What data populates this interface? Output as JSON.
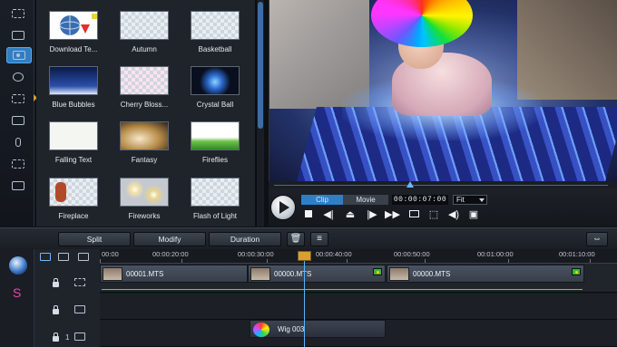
{
  "library": {
    "items": [
      {
        "label": "Download Te..."
      },
      {
        "label": "Autumn"
      },
      {
        "label": "Basketball"
      },
      {
        "label": "Blue Bubbles"
      },
      {
        "label": "Cherry Bloss..."
      },
      {
        "label": "Crystal Ball"
      },
      {
        "label": "Falling Text"
      },
      {
        "label": "Fantasy"
      },
      {
        "label": "Fireflies"
      },
      {
        "label": "Fireplace"
      },
      {
        "label": "Fireworks"
      },
      {
        "label": "Flash of Light"
      }
    ]
  },
  "player": {
    "tab_clip": "Clip",
    "tab_movie": "Movie",
    "timecode": "00:00:07:00",
    "zoom": "Fit"
  },
  "editbar": {
    "split": "Split",
    "modify": "Modify",
    "duration": "Duration"
  },
  "timeline": {
    "ruler": [
      "00:00",
      "00:00:20:00",
      "00:00:30:00",
      "00:00:40:00",
      "00:00:50:00",
      "00:01:00:00",
      "00:01:10:00"
    ],
    "clips": [
      {
        "name": "00001.MTS"
      },
      {
        "name": "00000.MTS"
      },
      {
        "name": "00000.MTS"
      }
    ],
    "effect_clip": {
      "name": "Wig 003"
    },
    "track_number": "1"
  }
}
